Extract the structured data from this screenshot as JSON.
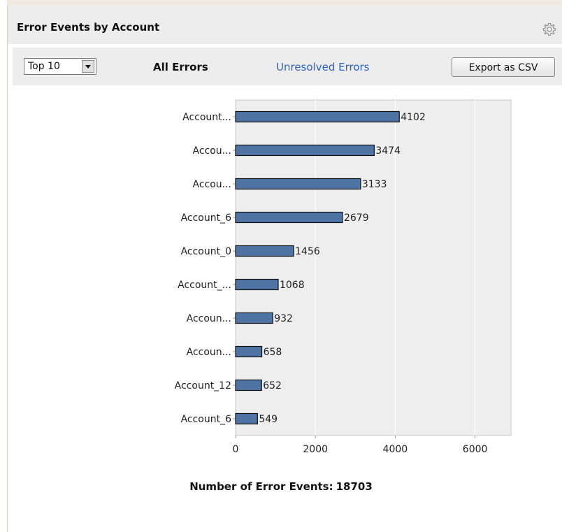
{
  "header": {
    "title": "Error Events by Account"
  },
  "toolbar": {
    "select_value": "Top 10",
    "tab_all": "All Errors",
    "tab_unresolved": "Unresolved Errors",
    "export_label": "Export as CSV"
  },
  "summary": {
    "label": "Number of Error Events:",
    "value": "18703"
  },
  "colors": {
    "bar": "#4f74a3",
    "link": "#2a62c9",
    "plot_bg": "#eeeeee"
  },
  "chart_data": {
    "type": "bar",
    "orientation": "horizontal",
    "categories": [
      "Account...",
      "Accou...",
      "Accou...",
      "Account_6",
      "Account_0",
      "Account_...",
      "Accoun...",
      "Accoun...",
      "Account_12",
      "Account_6"
    ],
    "values": [
      4102,
      3474,
      3133,
      2679,
      1456,
      1068,
      932,
      658,
      652,
      549
    ],
    "xticks": [
      0,
      2000,
      4000,
      6000
    ],
    "xlim": [
      0,
      6900
    ],
    "grid": true,
    "xlabel": "",
    "ylabel": ""
  }
}
